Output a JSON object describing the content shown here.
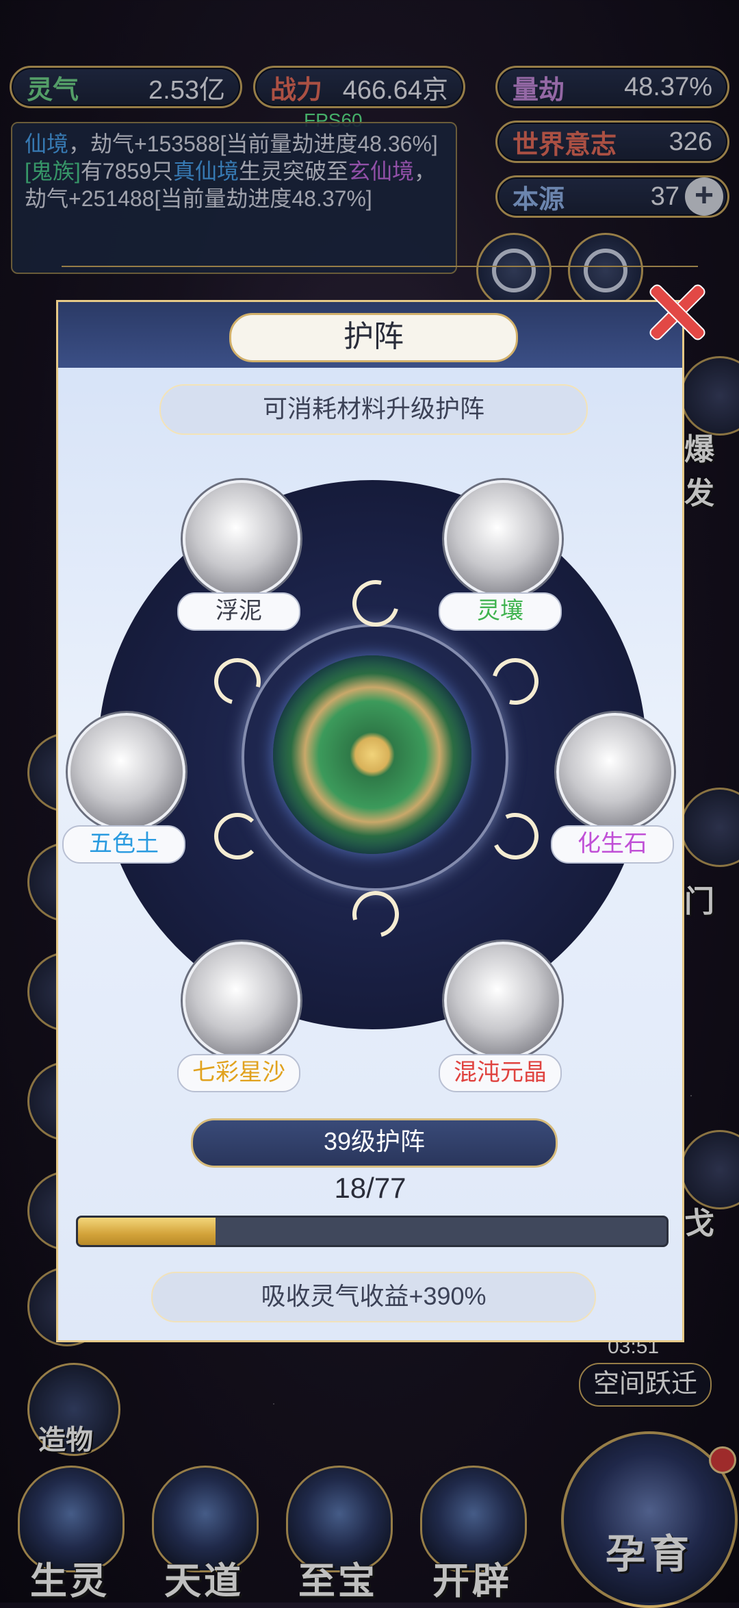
{
  "hud": {
    "lingqi": {
      "label": "灵气",
      "value": "2.53亿"
    },
    "zhanli": {
      "label": "战力",
      "value": "466.64京"
    },
    "liangjie": {
      "label": "量劫",
      "value": "48.37%"
    },
    "shijie": {
      "label": "世界意志",
      "value": "326"
    },
    "benyuan": {
      "label": "本源",
      "value": "37",
      "plus": "+"
    },
    "fps": "FPS60"
  },
  "log": {
    "line1_a": "仙境",
    "line1_b": "，劫气+153588[当前量劫进度48.36%]",
    "line2_a": "[鬼族]",
    "line2_b": "有7859只",
    "line2_c": "真仙境",
    "line2_d": "生灵突破至",
    "line2_e": "玄仙境",
    "line2_f": "，劫气+251488[当前量劫进度48.37%]"
  },
  "side": {
    "right_label_top": "爆发",
    "right_label_mid": "门",
    "right_label_low": "戈",
    "timer": "03:51",
    "kongjian": "空间跃迁",
    "zaowu": "造物"
  },
  "dialog": {
    "title": "护阵",
    "subtitle": "可消耗材料升级护阵",
    "materials": [
      {
        "name": "浮泥"
      },
      {
        "name": "灵壤"
      },
      {
        "name": "五色土"
      },
      {
        "name": "化生石"
      },
      {
        "name": "七彩星沙"
      },
      {
        "name": "混沌元晶"
      }
    ],
    "level": "39级护阵",
    "progress_text": "18/77",
    "progress_fraction": 0.234,
    "bonus": "吸收灵气收益+390%"
  },
  "nav": {
    "items": [
      {
        "label": "生灵"
      },
      {
        "label": "天道"
      },
      {
        "label": "至宝"
      },
      {
        "label": "开辟"
      }
    ],
    "yunyu": "孕育"
  }
}
